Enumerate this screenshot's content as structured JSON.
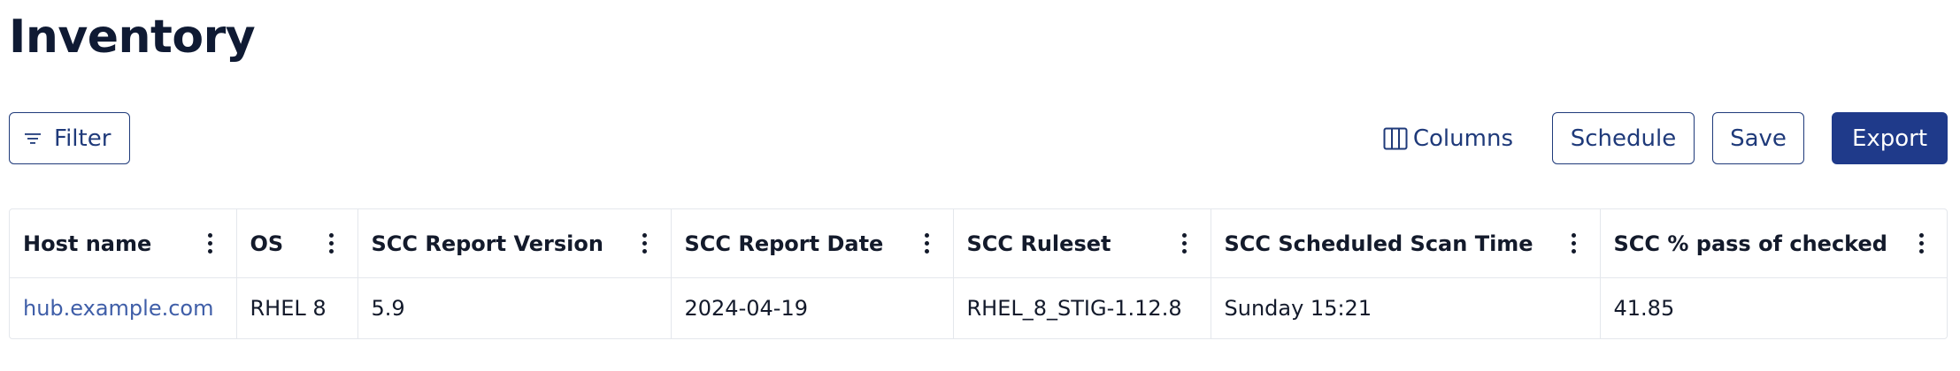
{
  "page": {
    "title": "Inventory"
  },
  "toolbar": {
    "filter_label": "Filter",
    "columns_label": "Columns",
    "schedule_label": "Schedule",
    "save_label": "Save",
    "export_label": "Export"
  },
  "table": {
    "columns": [
      "Host name",
      "OS",
      "SCC Report Version",
      "SCC Report Date",
      "SCC Ruleset",
      "SCC Scheduled Scan Time",
      "SCC % pass of checked"
    ],
    "rows": [
      [
        "hub.example.com",
        "RHEL 8",
        "5.9",
        "2024-04-19",
        "RHEL_8_STIG-1.12.8",
        "Sunday 15:21",
        "41.85"
      ]
    ]
  },
  "icons": {
    "filter": "filter-icon",
    "columns": "columns-icon",
    "column_menu": "kebab-menu-icon"
  },
  "colors": {
    "primary": "#1f3a8a",
    "link": "#3f5ea8",
    "text": "#131a2b",
    "border": "#e4e7ec"
  }
}
